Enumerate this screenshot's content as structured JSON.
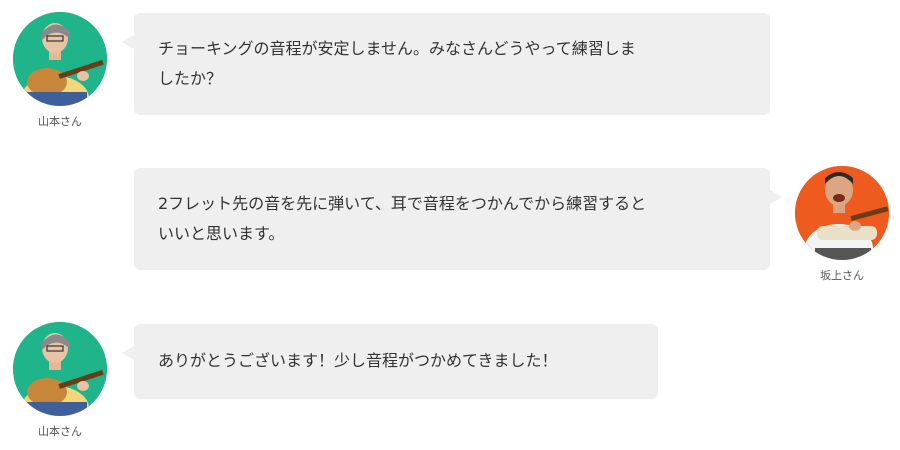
{
  "colors": {
    "bubble_bg": "#efefef",
    "avatar_yamamoto_bg": "#1fb489",
    "avatar_sakagami_bg": "#ef5a1e",
    "text": "#333333"
  },
  "messages": [
    {
      "sender": "山本さん",
      "side": "left",
      "avatar_icon": "guitarist-avatar-icon",
      "lines": [
        "チョーキングの音程が安定しません。みなさんどうやって練習しま",
        "したか？"
      ]
    },
    {
      "sender": "坂上さん",
      "side": "right",
      "avatar_icon": "guitarist-avatar-icon",
      "lines": [
        "2フレット先の音を先に弾いて、耳で音程をつかんでから練習すると",
        "いいと思います。"
      ]
    },
    {
      "sender": "山本さん",
      "side": "left",
      "avatar_icon": "guitarist-avatar-icon",
      "lines": [
        "ありがとうございます！少し音程がつかめてきました！"
      ]
    }
  ]
}
